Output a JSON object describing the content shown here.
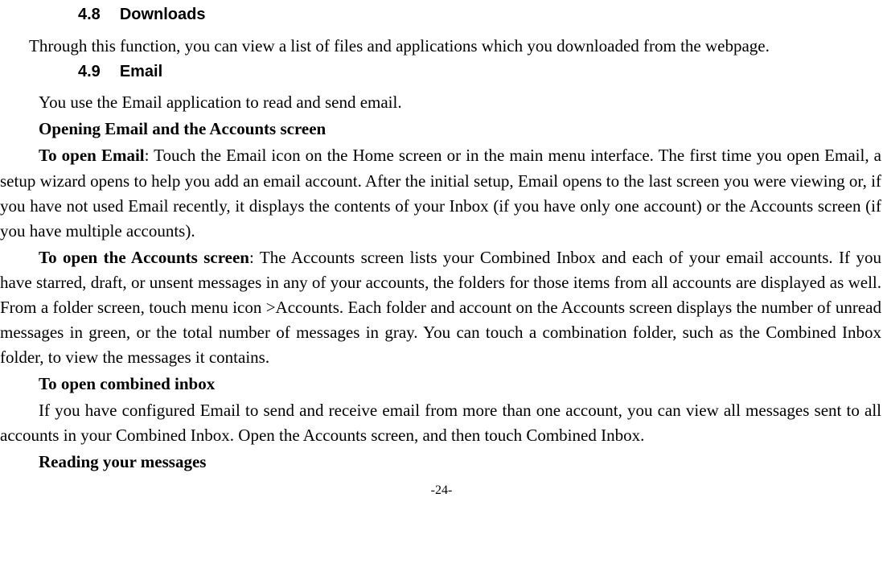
{
  "sections": {
    "s48": {
      "num": "4.8",
      "title": "Downloads"
    },
    "s49": {
      "num": "4.9",
      "title": "Email"
    }
  },
  "paras": {
    "downloads_intro": "Through this function, you can view a list of files and applications which you downloaded from the webpage.",
    "email_intro": "You use the Email application to read and send email.",
    "email_heading_opening": "Opening Email and the Accounts screen",
    "to_open_email_label": "To open Email",
    "to_open_email_body": ": Touch the Email icon on the Home screen or in the main menu interface. The first time you open Email, a setup wizard opens to help you add an email account. After the initial setup, Email opens to the last screen you were viewing or, if you have not used Email recently, it displays the contents of your Inbox (if you have only one account) or the Accounts screen (if you have multiple accounts).",
    "to_open_accounts_label": "To open the Accounts screen",
    "to_open_accounts_body": ": The Accounts screen lists your Combined Inbox and each of your email accounts. If you have starred, draft, or unsent messages in any of your accounts, the folders for those items from all accounts are displayed as well. From a folder screen, touch menu icon >Accounts. Each folder and account on the Accounts screen displays the number of unread messages in green, or the total number of messages in gray. You can touch a combination folder, such as the Combined Inbox folder, to view the messages it contains.",
    "to_open_combined_label": "To open combined inbox",
    "to_open_combined_body": "If you have configured Email to send and receive email from more than one account, you can view all messages sent to all accounts in your Combined Inbox. Open the Accounts screen, and then touch Combined Inbox.",
    "reading_label": "Reading your messages"
  },
  "page_number": "-24-"
}
